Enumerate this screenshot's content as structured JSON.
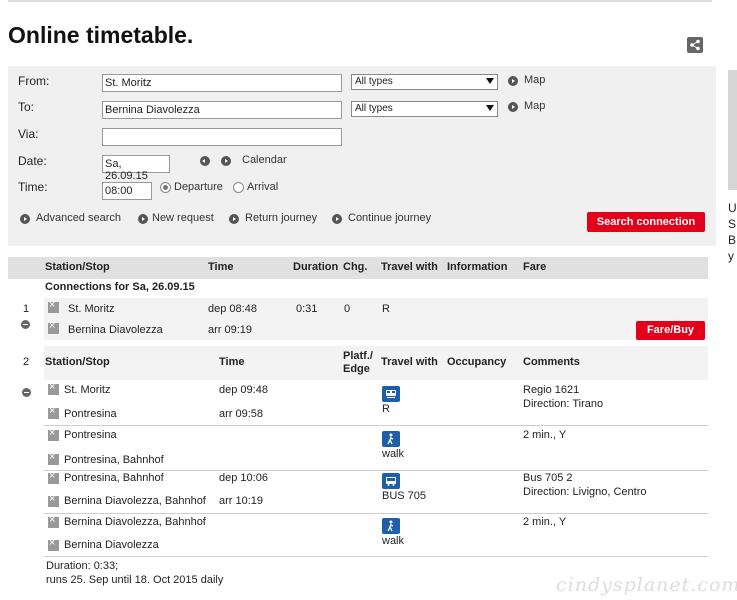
{
  "page": {
    "title": "Online timetable."
  },
  "form": {
    "from_label": "From:",
    "from_value": "St. Moritz",
    "from_type": "All types",
    "from_map": "Map",
    "to_label": "To:",
    "to_value": "Bernina Diavolezza",
    "to_type": "All types",
    "to_map": "Map",
    "via_label": "Via:",
    "via_value": "",
    "date_label": "Date:",
    "date_value": "Sa, 26.09.15",
    "calendar": "Calendar",
    "time_label": "Time:",
    "time_value": "08:00",
    "departure": "Departure",
    "arrival": "Arrival",
    "links": [
      "Advanced search",
      "New request",
      "Return journey",
      "Continue journey"
    ],
    "search_button": "Search connection"
  },
  "results": {
    "headers": [
      "Station/Stop",
      "Time",
      "Duration",
      "Chg.",
      "Travel with",
      "Information",
      "Fare"
    ],
    "connections_title": "Connections for Sa, 26.09.15",
    "conn1": {
      "num": "1",
      "from": "St. Moritz",
      "to": "Bernina Diavolezza",
      "dep": "dep 08:48",
      "arr": "arr  09:19",
      "duration": "0:31",
      "changes": "0",
      "travel": "R",
      "fare_button": "Fare/Buy"
    },
    "conn2": {
      "num": "2",
      "headers": [
        "Station/Stop",
        "Time",
        "Platf./",
        "Edge",
        "Travel with",
        "Occupancy",
        "Comments"
      ],
      "legs": [
        {
          "from": "St. Moritz",
          "dep": "dep 09:48",
          "to": "Pontresina",
          "arr": "arr  09:58",
          "mode": "R",
          "comment1": "Regio 1621",
          "comment2": "Direction: Tirano"
        },
        {
          "from": "Pontresina",
          "dep": "",
          "to": "Pontresina, Bahnhof",
          "arr": "",
          "mode": "walk",
          "comment1": "2 min., Y",
          "comment2": ""
        },
        {
          "from": "Pontresina, Bahnhof",
          "dep": "dep 10:06",
          "to": "Bernina Diavolezza, Bahnhof",
          "arr": "arr  10:19",
          "mode": "BUS 705",
          "comment1": "Bus 705 2",
          "comment2": "Direction: Livigno, Centro"
        },
        {
          "from": "Bernina Diavolezza, Bahnhof",
          "dep": "",
          "to": "Bernina Diavolezza",
          "arr": "",
          "mode": "walk",
          "comment1": "2 min., Y",
          "comment2": ""
        }
      ],
      "duration": "Duration: 0:33;",
      "runs": "runs 25. Sep until 18. Oct 2015 daily"
    }
  },
  "sidebar_snip": [
    "U",
    "S",
    "B",
    "y"
  ],
  "watermark": "cindysplanet.com",
  "colors": {
    "accent": "#e2001a",
    "mode_icon": "#1f5ea8"
  }
}
